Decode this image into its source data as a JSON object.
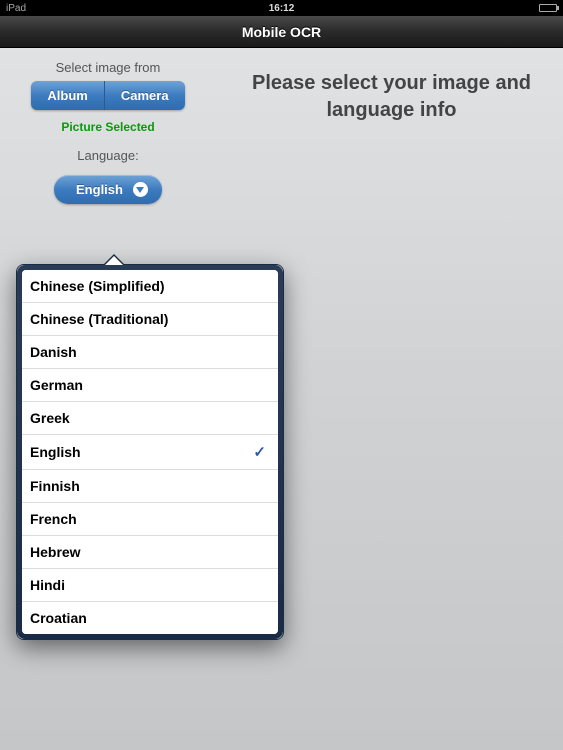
{
  "statusBar": {
    "carrier": "iPad",
    "time": "16:12"
  },
  "navBar": {
    "title": "Mobile OCR"
  },
  "leftPanel": {
    "sourceLabel": "Select image from",
    "albumButton": "Album",
    "cameraButton": "Camera",
    "statusText": "Picture Selected",
    "languageLabel": "Language:",
    "selectedLanguage": "English"
  },
  "mainPrompt": "Please select your image and language info",
  "languageOptions": [
    {
      "label": "Chinese (Simplified)",
      "selected": false
    },
    {
      "label": "Chinese (Traditional)",
      "selected": false
    },
    {
      "label": "Danish",
      "selected": false
    },
    {
      "label": "German",
      "selected": false
    },
    {
      "label": "Greek",
      "selected": false
    },
    {
      "label": "English",
      "selected": true
    },
    {
      "label": "Finnish",
      "selected": false
    },
    {
      "label": "French",
      "selected": false
    },
    {
      "label": "Hebrew",
      "selected": false
    },
    {
      "label": "Hindi",
      "selected": false
    },
    {
      "label": "Croatian",
      "selected": false
    }
  ]
}
